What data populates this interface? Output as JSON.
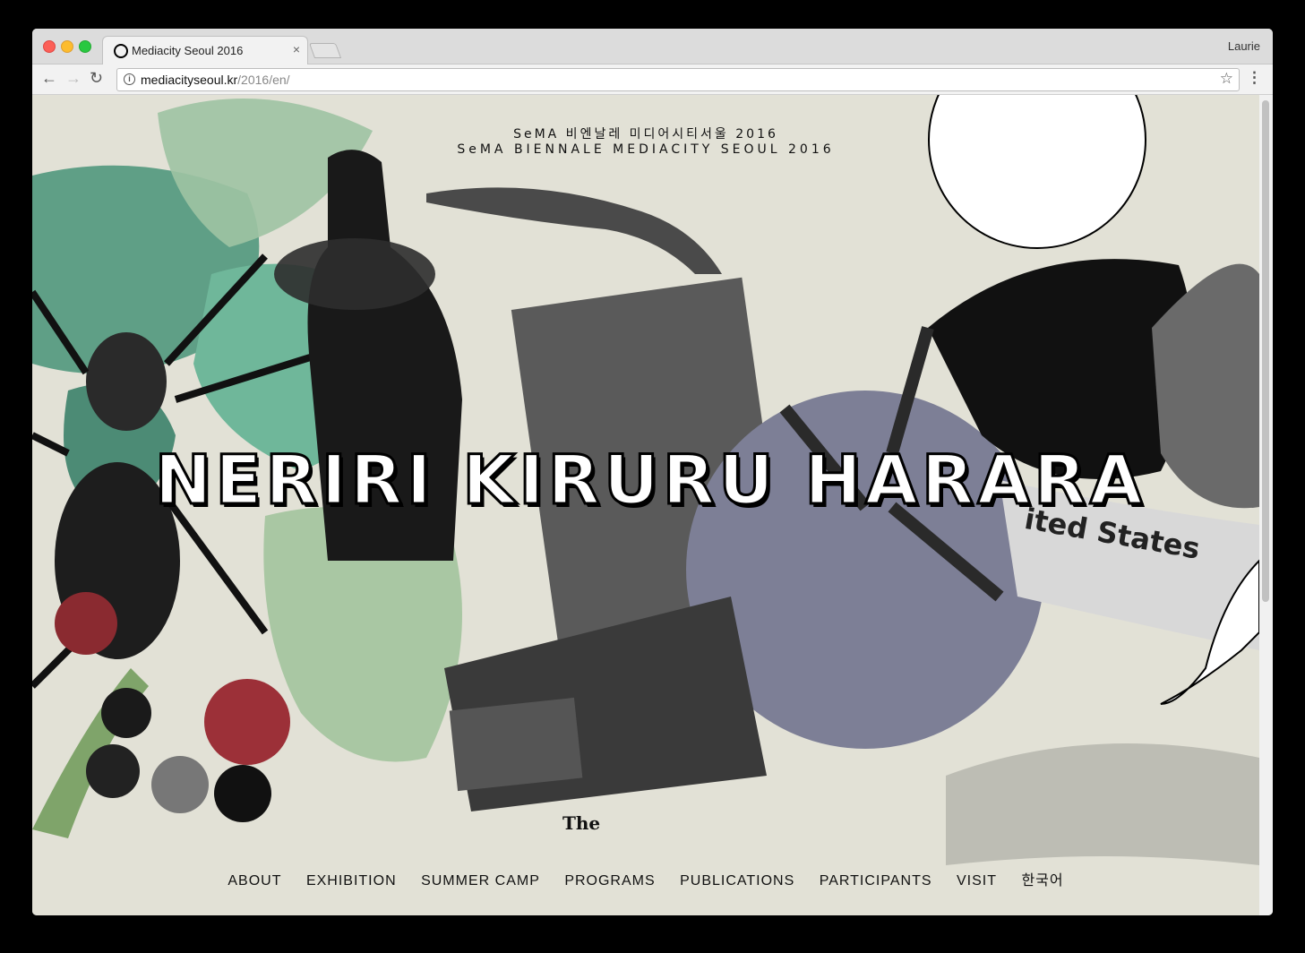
{
  "browser": {
    "tab_title": "Mediacity Seoul 2016",
    "tab_close": "×",
    "profile_name": "Laurie",
    "url_host": "mediacityseoul.kr",
    "url_path": "/2016/en/"
  },
  "page": {
    "subtitle_kr": "SeMA 비엔날레 미디어시티서울 2016",
    "subtitle_en": "SeMA BIENNALE MEDIACITY SEOUL 2016",
    "title": "NERIRI KIRURU HARARA",
    "collage_text_the": "The",
    "collage_text_states": "ited States"
  },
  "nav": {
    "items": [
      "ABOUT",
      "EXHIBITION",
      "SUMMER CAMP",
      "PROGRAMS",
      "PUBLICATIONS",
      "PARTICIPANTS",
      "VISIT",
      "한국어"
    ]
  }
}
